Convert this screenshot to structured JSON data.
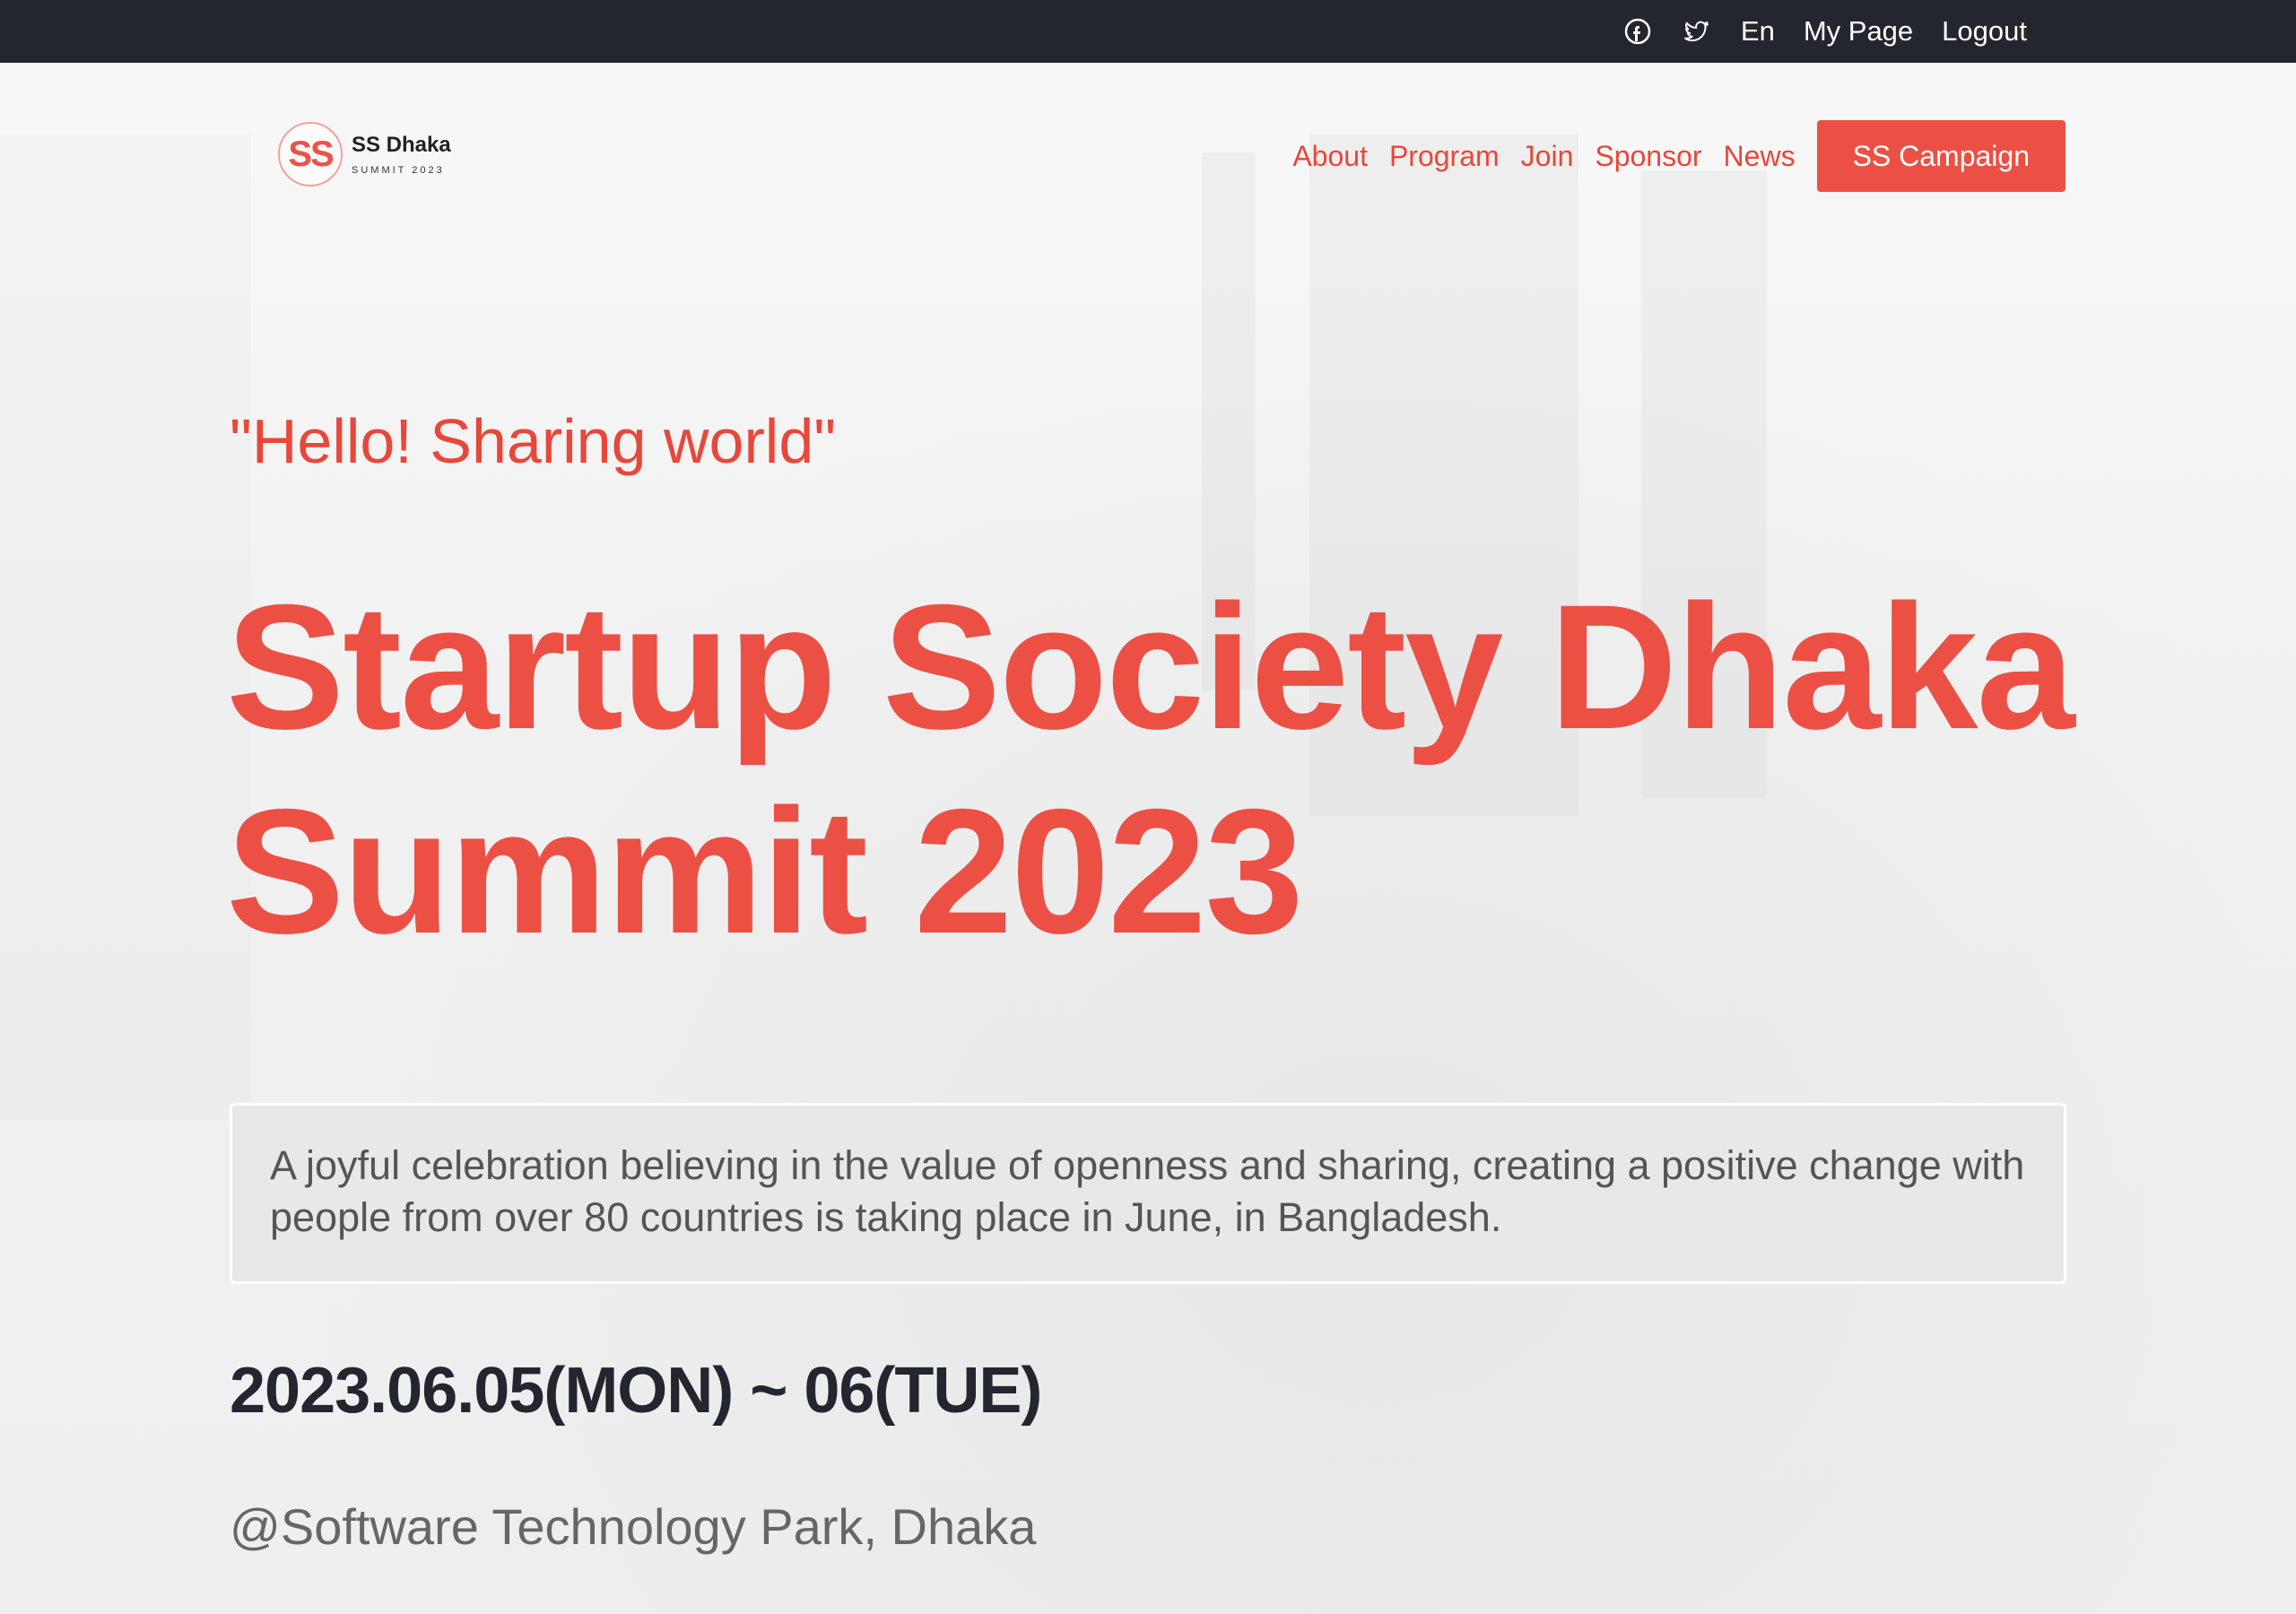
{
  "topbar": {
    "facebook_icon": "facebook-icon",
    "twitter_icon": "twitter-icon",
    "language": "En",
    "my_page": "My Page",
    "logout": "Logout"
  },
  "logo": {
    "mark": "SS",
    "name": "SS Dhaka",
    "sub": "SUMMIT 2023"
  },
  "nav": {
    "items": [
      "About",
      "Program",
      "Join",
      "Sponsor",
      "News"
    ],
    "cta": "SS Campaign"
  },
  "hero": {
    "tagline": "\"Hello! Sharing world\"",
    "title_line1": "Startup Society Dhaka",
    "title_line2": "Summit 2023",
    "description": "A joyful celebration believing in the value of openness and sharing, creating a positive change with people from over 80 countries is taking place in June, in Bangladesh.",
    "date": "2023.06.05(MON) ~ 06(TUE)",
    "venue": "@Software Technology Park, Dhaka"
  },
  "colors": {
    "accent": "#ec5045",
    "topbar": "#23262e",
    "text_dark": "#23262e",
    "text_muted": "#666666"
  }
}
